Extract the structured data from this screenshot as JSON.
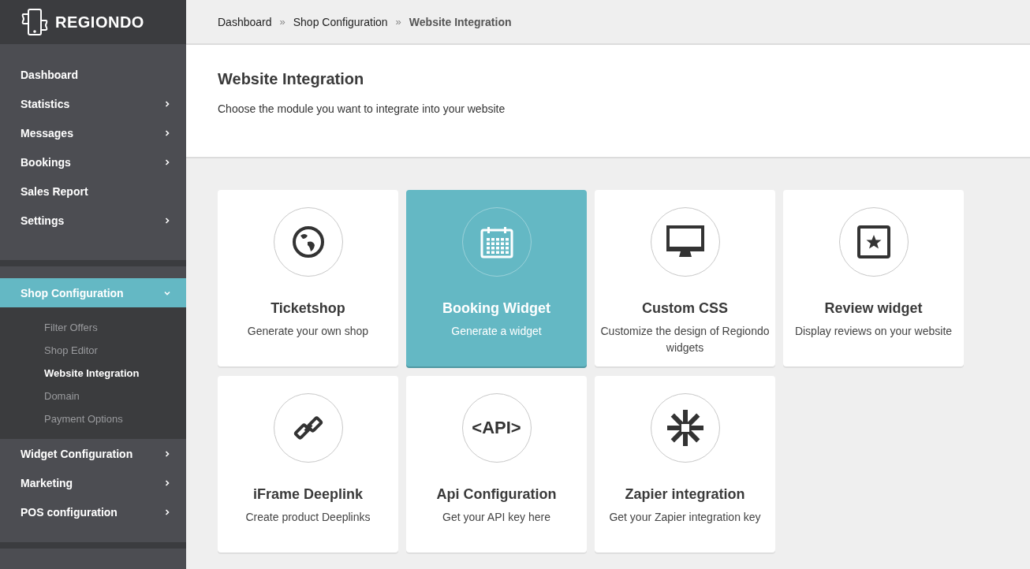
{
  "sidebar": {
    "logo": "REGIONDO",
    "items": [
      {
        "label": "Dashboard",
        "has_arrow": false,
        "selected": false
      },
      {
        "label": "Statistics",
        "has_arrow": true,
        "selected": false
      },
      {
        "label": "Messages",
        "has_arrow": true,
        "selected": false
      },
      {
        "label": "Bookings",
        "has_arrow": true,
        "selected": false
      },
      {
        "label": "Sales Report",
        "has_arrow": false,
        "selected": false
      },
      {
        "label": "Settings",
        "has_arrow": true,
        "selected": false
      }
    ],
    "section": {
      "label": "Shop Configuration",
      "expanded": true,
      "selected": true,
      "children": [
        {
          "label": "Filter Offers",
          "selected": false
        },
        {
          "label": "Shop Editor",
          "selected": false
        },
        {
          "label": "Website Integration",
          "selected": true
        },
        {
          "label": "Domain",
          "selected": false
        },
        {
          "label": "Payment Options",
          "selected": false
        }
      ]
    },
    "items_after": [
      {
        "label": "Widget Configuration",
        "has_arrow": true,
        "selected": false
      },
      {
        "label": "Marketing",
        "has_arrow": true,
        "selected": false
      },
      {
        "label": "POS configuration",
        "has_arrow": true,
        "selected": false
      }
    ]
  },
  "breadcrumb": [
    "Dashboard",
    "Shop Configuration",
    "Website Integration"
  ],
  "breadcrumb_separator": "»",
  "header": {
    "title": "Website Integration",
    "subtitle": "Choose the module you want to integrate into your website"
  },
  "cards": [
    {
      "kind": "globe",
      "title": "Ticketshop",
      "description": "Generate your own shop",
      "selected": false
    },
    {
      "kind": "calendar",
      "title": "Booking Widget",
      "description": "Generate a widget",
      "selected": true
    },
    {
      "kind": "monitor",
      "title": "Custom CSS",
      "description": "Customize the design of Regiondo widgets",
      "selected": false
    },
    {
      "kind": "star",
      "title": "Review widget",
      "description": "Display reviews on your website",
      "selected": false
    },
    {
      "kind": "link",
      "title": "iFrame Deeplink",
      "description": "Create product Deeplinks",
      "selected": false
    },
    {
      "kind": "text",
      "icon_text": "<API>",
      "title": "Api Configuration",
      "description": "Get your API key here",
      "selected": false
    },
    {
      "kind": "asterisk",
      "title": "Zapier integration",
      "description": "Get your Zapier integration key",
      "selected": false
    }
  ]
}
